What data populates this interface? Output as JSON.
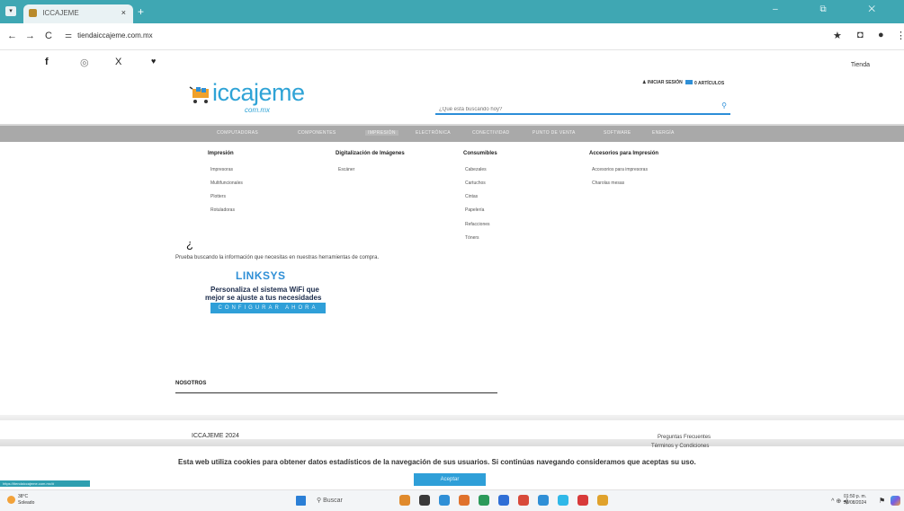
{
  "browser": {
    "tab_title": "ICCAJEME",
    "tab_close": "×",
    "tab_menu": "▾",
    "new_tab": "+",
    "window_controls": "–  ⧉  ✕",
    "nav": {
      "back": "←",
      "forward": "→",
      "reload": "C"
    },
    "url": "tiendaiccajeme.com.mx",
    "toolbar_icons": [
      "star-icon",
      "extensions-icon",
      "profile-icon",
      "menu-icon"
    ],
    "toolbar_glyphs": [
      "★",
      "◘",
      "●",
      "⋮"
    ]
  },
  "social": {
    "items": [
      {
        "name": "facebook-icon",
        "glyph": "f"
      },
      {
        "name": "instagram-icon",
        "glyph": "◎"
      },
      {
        "name": "x-icon",
        "glyph": "X"
      },
      {
        "name": "location-icon",
        "glyph": "♥"
      }
    ]
  },
  "header": {
    "tienda": "Tienda",
    "logo_main": "iccajeme",
    "logo_sub": "com.mx",
    "login": "INICIAR SESIÓN",
    "cart": "0 ARTÍCULOS",
    "search_placeholder": "¿Qué está buscando hoy?",
    "search_icon": "🔍"
  },
  "menu": [
    "COMPUTADORAS",
    "COMPONENTES",
    "IMPRESIÓN",
    "ELECTRÓNICA",
    "CONECTIVIDAD",
    "PUNTO DE VENTA",
    "SOFTWARE",
    "ENERGÍA"
  ],
  "mega_menu": [
    {
      "title": "Impresión",
      "items": [
        "Impresoras",
        "Multifuncionales",
        "Plotters",
        "Rotuladoras"
      ]
    },
    {
      "title": "Digitalización de Imágenes",
      "items": [
        "Escáner"
      ]
    },
    {
      "title": "Consumibles",
      "items": [
        "Cabezales",
        "Cartuchos",
        "Cintas",
        "Papelería",
        "Refacciones",
        "Tóners"
      ]
    },
    {
      "title": "Accesorios para Impresión",
      "items": [
        "Accesorios para impresoras",
        "Charolas mesas"
      ]
    }
  ],
  "content": {
    "qmark": "¿",
    "prompt": "Prueba buscando la información que necesitas en nuestras herramientas de compra."
  },
  "banner": {
    "brand": "LINKSYS",
    "line1": "Personaliza el sistema WiFi que",
    "line2": "mejor se ajuste a tus necesidades",
    "button": "CONFIGURAR AHORA"
  },
  "footer": {
    "nosotros": "NOSOTROS",
    "copyright": "ICCAJEME 2024",
    "faq": "Preguntas Frecuentes",
    "terms": "Términos y Condiciones"
  },
  "cookie": {
    "message": "Esta web utiliza cookies para obtener datos estadísticos de la navegación de sus usuarios. Si continúas navegando consideramos que aceptas su uso.",
    "accept": "Aceptar"
  },
  "status_bar": {
    "url": "https://tiendaiccajeme.com.mx/#"
  },
  "taskbar": {
    "weather_temp": "38°C",
    "weather_desc": "Soleado",
    "search": "Buscar",
    "time": "01:50 p. m.",
    "date": "30/08/2024",
    "tray": "^  ⊕  ◂)",
    "bell": "⚑",
    "app_colors": [
      "#e08a2c",
      "#3a3a3a",
      "#2f8fd6",
      "#e0722c",
      "#2c9a5a",
      "#2f6fd6",
      "#d84a3a",
      "#2f8fd6",
      "#2fb8e8",
      "#d83a3a",
      "#e0a22c"
    ]
  }
}
